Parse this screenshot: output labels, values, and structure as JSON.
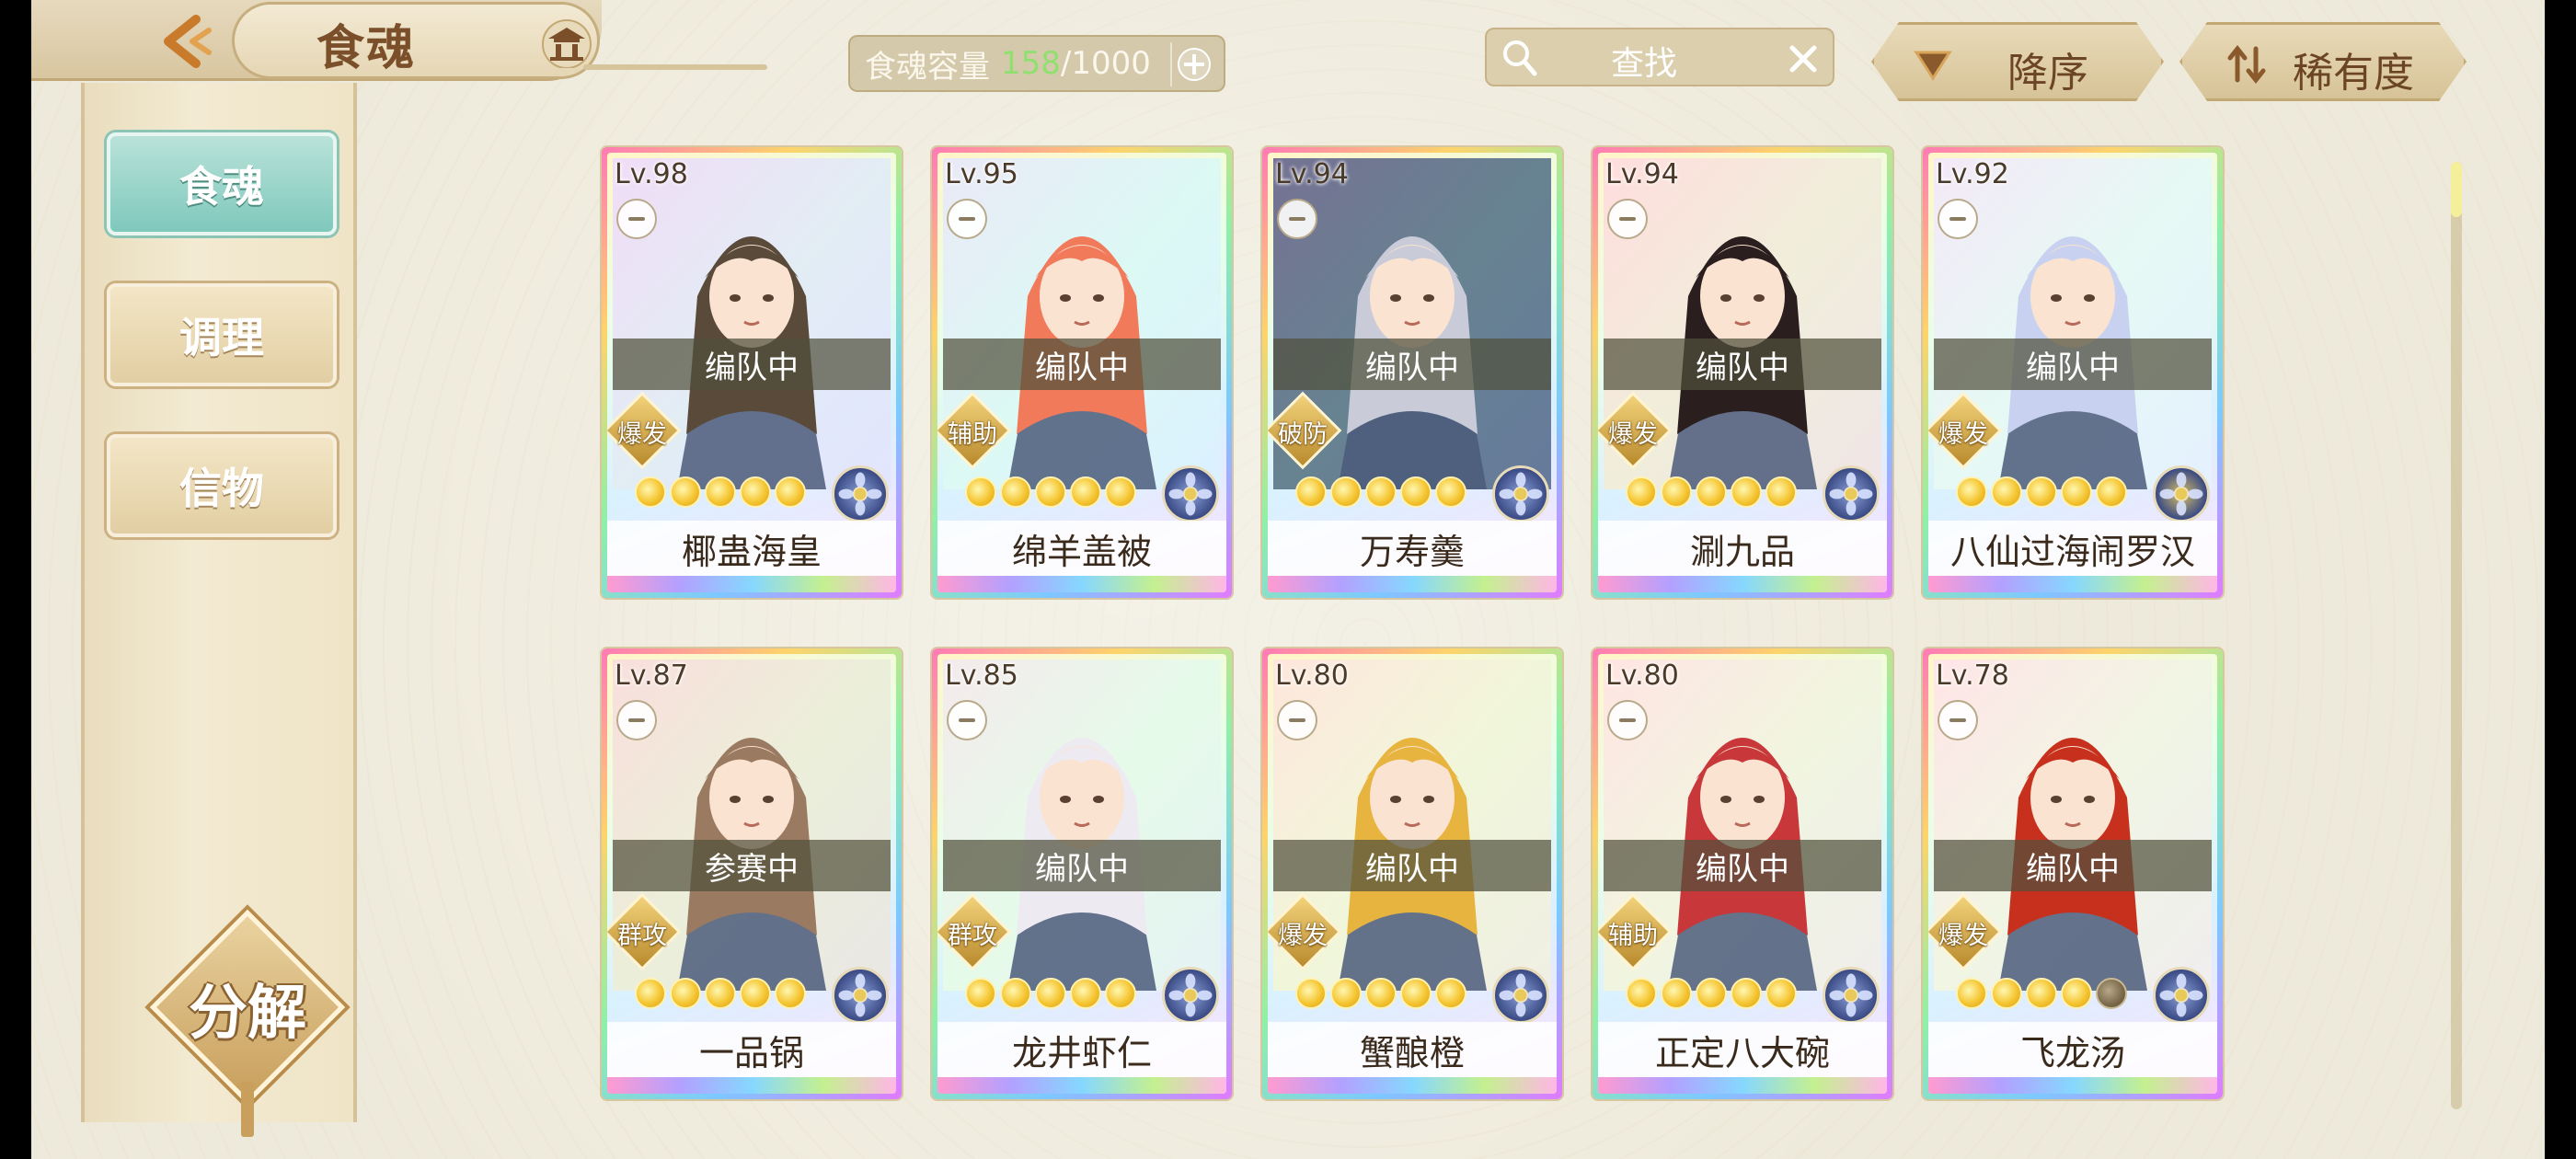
{
  "header": {
    "title": "食魂",
    "capacity": {
      "label": "食魂容量",
      "current": "158",
      "separator": "/",
      "max": "1000"
    },
    "search_placeholder": "查找",
    "sort_order_label": "降序",
    "sort_key_label": "稀有度"
  },
  "sidebar": {
    "tabs": [
      {
        "label": "食魂",
        "active": true
      },
      {
        "label": "调理",
        "active": false
      },
      {
        "label": "信物",
        "active": false
      }
    ],
    "decompose_label": "分解"
  },
  "colors": {
    "accent_teal": "#7fc8bc",
    "gold": "#c89f5c",
    "capacity_current": "#8fe06f"
  },
  "cards": [
    {
      "level": "Lv.98",
      "status": "编队中",
      "role": "爆发",
      "name": "椰蛊海皇",
      "stars": 5,
      "element": "flower-emblem",
      "hair": "#5a4a3a",
      "bg": "#e9e3ff"
    },
    {
      "level": "Lv.95",
      "status": "编队中",
      "role": "辅助",
      "name": "绵羊盖被",
      "stars": 5,
      "element": "flower-emblem",
      "hair": "#f07a5a",
      "bg": "#dff6ff"
    },
    {
      "level": "Lv.94",
      "status": "编队中",
      "role": "破防",
      "name": "万寿羹",
      "stars": 5,
      "element": "flower-emblem",
      "hair": "#c9ccd8",
      "bg": "#2b3f66"
    },
    {
      "level": "Lv.94",
      "status": "编队中",
      "role": "爆发",
      "name": "涮九品",
      "stars": 5,
      "element": "flower-emblem",
      "hair": "#2a1e1e",
      "bg": "#ffe4d8"
    },
    {
      "level": "Lv.92",
      "status": "编队中",
      "role": "爆发",
      "name": "八仙过海闹罗汉",
      "stars": 5,
      "element": "gold-emblem",
      "hair": "#c8d2f0",
      "bg": "#eef6ff"
    },
    {
      "level": "Lv.87",
      "status": "参赛中",
      "role": "群攻",
      "name": "一品锅",
      "stars": 5,
      "element": "flower-emblem",
      "hair": "#9a7a60",
      "bg": "#f6e6d6"
    },
    {
      "level": "Lv.85",
      "status": "编队中",
      "role": "群攻",
      "name": "龙井虾仁",
      "stars": 5,
      "element": "flower-emblem",
      "hair": "#eeeaf2",
      "bg": "#eef8ee"
    },
    {
      "level": "Lv.80",
      "status": "编队中",
      "role": "爆发",
      "name": "蟹酿橙",
      "stars": 5,
      "element": "flower-emblem",
      "hair": "#e8b440",
      "bg": "#fff2d6"
    },
    {
      "level": "Lv.80",
      "status": "编队中",
      "role": "辅助",
      "name": "正定八大碗",
      "stars": 5,
      "element": "flower-emblem",
      "hair": "#c8383a",
      "bg": "#fff0e0"
    },
    {
      "level": "Lv.78",
      "status": "编队中",
      "role": "爆发",
      "name": "飞龙汤",
      "stars": 4,
      "element": "flower-emblem",
      "hair": "#c8301e",
      "bg": "#fff0e6"
    }
  ]
}
